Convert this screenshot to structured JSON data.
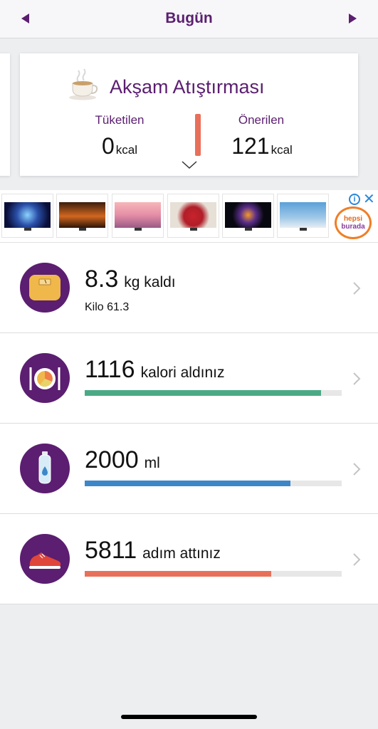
{
  "header": {
    "date_label": "Bugün",
    "prev_icon": "triangle-left-icon",
    "next_icon": "triangle-right-icon"
  },
  "meal": {
    "title": "Akşam Atıştırması",
    "icon": "coffee-cup-icon",
    "consumed_label": "Tüketilen",
    "consumed_value": "0",
    "consumed_unit": "kcal",
    "recommended_label": "Önerilen",
    "recommended_value": "121",
    "recommended_unit": "kcal",
    "bar_color": "#e8705a"
  },
  "ad": {
    "brand_line1": "hepsi",
    "brand_line2": "burada",
    "adchoices_icon": "i",
    "close_icon": "✕",
    "thumbnails": [
      "tv-1",
      "tv-2",
      "tv-3",
      "tv-4",
      "tv-5",
      "tv-6"
    ]
  },
  "rows": [
    {
      "id": "weight",
      "icon": "scale-icon",
      "value": "8.3",
      "label": "kg kaldı",
      "sub": "Kilo 61.3"
    },
    {
      "id": "calories",
      "icon": "plate-icon",
      "value": "1116",
      "label": "kalori aldınız",
      "progress": 0.92,
      "color": "#4aaa86"
    },
    {
      "id": "water",
      "icon": "water-bottle-icon",
      "value": "2000",
      "label": "ml",
      "progress": 0.8,
      "color": "#3d87c8"
    },
    {
      "id": "steps",
      "icon": "sneaker-icon",
      "value": "5811",
      "label": "adım attınız",
      "progress": 0.725,
      "color": "#e8705a"
    }
  ]
}
